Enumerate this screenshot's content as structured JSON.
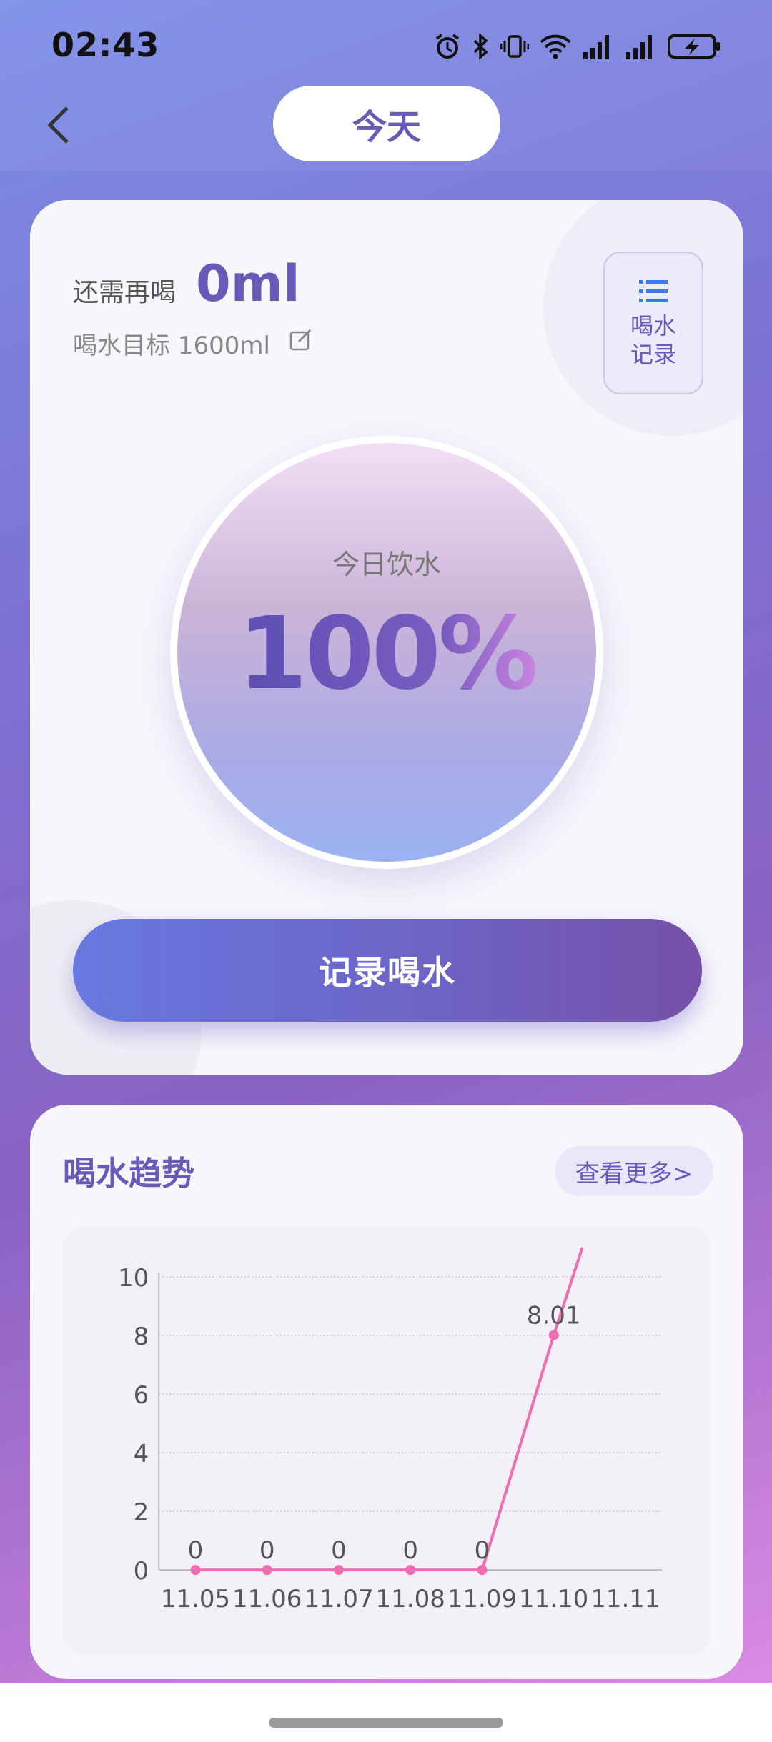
{
  "status": {
    "time": "02:43",
    "icons": [
      "alarm-icon",
      "bluetooth-icon",
      "vibrate-icon",
      "wifi-icon",
      "signal-icon",
      "signal-icon",
      "battery-charging-icon"
    ]
  },
  "header": {
    "title": "今天"
  },
  "summary": {
    "need_label": "还需再喝",
    "need_value": "0ml",
    "goal_text": "喝水目标 1600ml",
    "record_button_label": "喝水记录"
  },
  "progress": {
    "label": "今日饮水",
    "percent_text": "100%",
    "percent": 100
  },
  "actions": {
    "record_button": "记录喝水"
  },
  "trend": {
    "title": "喝水趋势",
    "more": "查看更多>"
  },
  "chart_data": {
    "type": "line",
    "categories": [
      "11.05",
      "11.06",
      "11.07",
      "11.08",
      "11.09",
      "11.10",
      "11.11"
    ],
    "values": [
      0,
      0,
      0,
      0,
      0,
      8.01,
      null
    ],
    "labels": [
      "0",
      "0",
      "0",
      "0",
      "0",
      "8.01",
      ""
    ],
    "ylim": [
      0,
      10
    ],
    "yticks": [
      "0",
      "2",
      "4",
      "6",
      "8",
      "10"
    ],
    "grid": true,
    "line_color": "#ee6db3",
    "overflow_point": {
      "x_index": 5.4,
      "y": 11
    }
  }
}
